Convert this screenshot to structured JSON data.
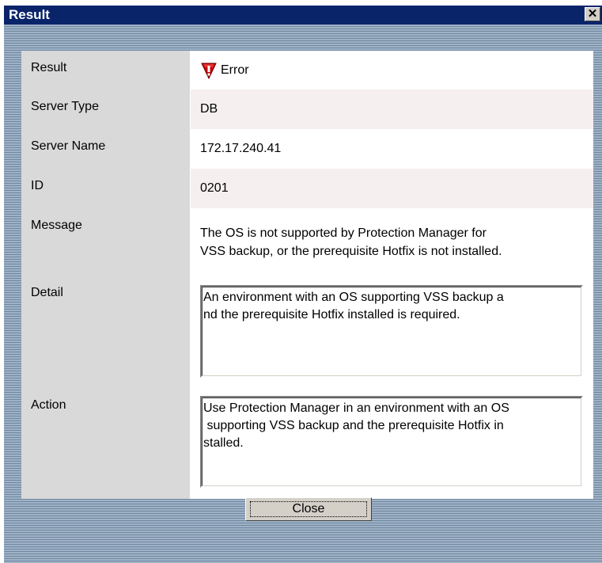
{
  "window": {
    "title": "Result",
    "close_glyph": "✕"
  },
  "rows": {
    "result": {
      "label": "Result",
      "value": "Error",
      "icon": "error-icon",
      "icon_color": "#cc0000"
    },
    "server_type": {
      "label": "Server Type",
      "value": "DB"
    },
    "server_name": {
      "label": "Server Name",
      "value": "172.17.240.41"
    },
    "id": {
      "label": "ID",
      "value": "0201"
    },
    "message": {
      "label": "Message",
      "line1": "The OS is not supported by Protection Manager for",
      "line2": "VSS backup, or the prerequisite Hotfix is not installed."
    },
    "detail": {
      "label": "Detail",
      "line1": "An environment with an OS supporting VSS backup a",
      "line2": "nd the prerequisite Hotfix installed is required."
    },
    "action": {
      "label": "Action",
      "line1": "Use Protection Manager in an environment with an OS",
      "line2": " supporting VSS backup and the prerequisite Hotfix in",
      "line3": "stalled."
    }
  },
  "buttons": {
    "close_label": "Close"
  }
}
